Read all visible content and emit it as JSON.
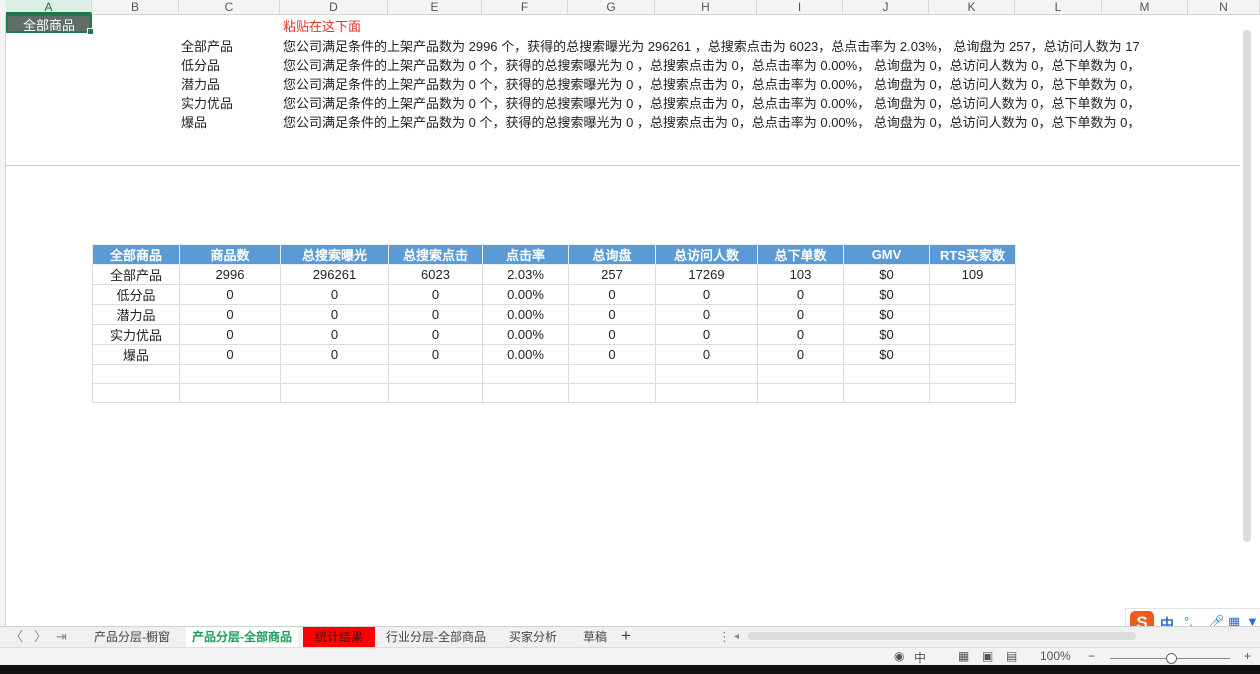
{
  "columns": [
    "A",
    "B",
    "C",
    "D",
    "E",
    "F",
    "G",
    "H",
    "I",
    "J",
    "K",
    "L",
    "M",
    "N"
  ],
  "selected_cell": {
    "value": "全部商品"
  },
  "paste_hint": "粘贴在这下面",
  "summary_rows": [
    {
      "label": "全部产品",
      "text": "您公司满足条件的上架产品数为 2996 个，获得的总搜索曝光为 296261 ，总搜索点击为 6023，总点击率为 2.03%， 总询盘为 257，总访问人数为 17"
    },
    {
      "label": "低分品",
      "text": "您公司满足条件的上架产品数为 0 个，获得的总搜索曝光为 0 ，总搜索点击为 0，总点击率为 0.00%， 总询盘为 0，总访问人数为 0，总下单数为 0，"
    },
    {
      "label": "潜力品",
      "text": "您公司满足条件的上架产品数为 0 个，获得的总搜索曝光为 0 ，总搜索点击为 0，总点击率为 0.00%， 总询盘为 0，总访问人数为 0，总下单数为 0，"
    },
    {
      "label": "实力优品",
      "text": "您公司满足条件的上架产品数为 0 个，获得的总搜索曝光为 0 ，总搜索点击为 0，总点击率为 0.00%， 总询盘为 0，总访问人数为 0，总下单数为 0，"
    },
    {
      "label": "爆品",
      "text": "您公司满足条件的上架产品数为 0 个，获得的总搜索曝光为 0 ，总搜索点击为 0，总点击率为 0.00%， 总询盘为 0，总访问人数为 0，总下单数为 0，"
    }
  ],
  "table": {
    "headers": [
      "全部商品",
      "商品数",
      "总搜索曝光",
      "总搜索点击",
      "点击率",
      "总询盘",
      "总访问人数",
      "总下单数",
      "GMV",
      "RTS买家数"
    ],
    "rows": [
      [
        "全部产品",
        "2996",
        "296261",
        "6023",
        "2.03%",
        "257",
        "17269",
        "103",
        "$0",
        "109"
      ],
      [
        "低分品",
        "0",
        "0",
        "0",
        "0.00%",
        "0",
        "0",
        "0",
        "$0",
        ""
      ],
      [
        "潜力品",
        "0",
        "0",
        "0",
        "0.00%",
        "0",
        "0",
        "0",
        "$0",
        ""
      ],
      [
        "实力优品",
        "0",
        "0",
        "0",
        "0.00%",
        "0",
        "0",
        "0",
        "$0",
        ""
      ],
      [
        "爆品",
        "0",
        "0",
        "0",
        "0.00%",
        "0",
        "0",
        "0",
        "$0",
        ""
      ],
      [
        "",
        "",
        "",
        "",
        "",
        "",
        "",
        "",
        "",
        ""
      ],
      [
        "",
        "",
        "",
        "",
        "",
        "",
        "",
        "",
        "",
        ""
      ]
    ]
  },
  "sheet_tabs": [
    {
      "label": "产品分层-橱窗",
      "state": "normal"
    },
    {
      "label": "产品分层-全部商品",
      "state": "active"
    },
    {
      "label": "统计结果",
      "state": "highlighted"
    },
    {
      "label": "行业分层-全部商品",
      "state": "normal"
    },
    {
      "label": "买家分析",
      "state": "normal"
    },
    {
      "label": "草稿",
      "state": "normal"
    }
  ],
  "ime": {
    "logo": "S",
    "mode": "中"
  },
  "status": {
    "zoom": "100%",
    "view_mode": "中"
  },
  "colors": {
    "header_blue": "#5a9bd5",
    "active_tab": "#1e9d5a",
    "red_tab": "#ff0000",
    "paste_hint": "#e0322c"
  }
}
